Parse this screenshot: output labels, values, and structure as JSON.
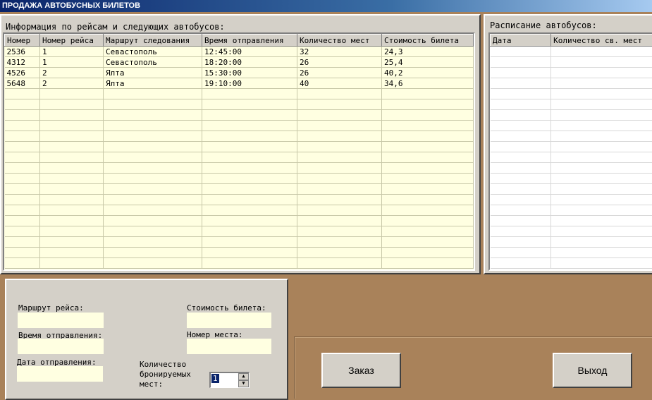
{
  "window": {
    "title": "ПРОДАЖА АВТОБУСНЫХ БИЛЕТОВ"
  },
  "flights": {
    "caption": "Информация по рейсам и следующих автобусов:",
    "columns": [
      "Номер",
      "Номер рейса",
      "Маршрут следования",
      "Время отправления",
      "Количество мест",
      "Стоимость билета"
    ],
    "rows": [
      [
        "2536",
        "1",
        "Севастополь",
        "12:45:00",
        "32",
        "24,3"
      ],
      [
        "4312",
        "1",
        "Севастополь",
        "18:20:00",
        "26",
        "25,4"
      ],
      [
        "4526",
        "2",
        "Ялта",
        "15:30:00",
        "26",
        "40,2"
      ],
      [
        "5648",
        "2",
        "Ялта",
        "19:10:00",
        "40",
        "34,6"
      ]
    ]
  },
  "schedule": {
    "caption": "Расписание автобусов:",
    "columns": [
      "Дата",
      "Количество св. мест"
    ]
  },
  "form": {
    "route_label": "Маршрут рейса:",
    "time_label": "Время отправления:",
    "date_label": "Дата отправления:",
    "price_label": "Стоимость билета:",
    "seat_label": "Номер места:",
    "booked_label_1": "Количество",
    "booked_label_2": "бронируемых",
    "booked_label_3": "мест:",
    "booked_value": "1"
  },
  "buttons": {
    "order": "Заказ",
    "exit": "Выход"
  }
}
